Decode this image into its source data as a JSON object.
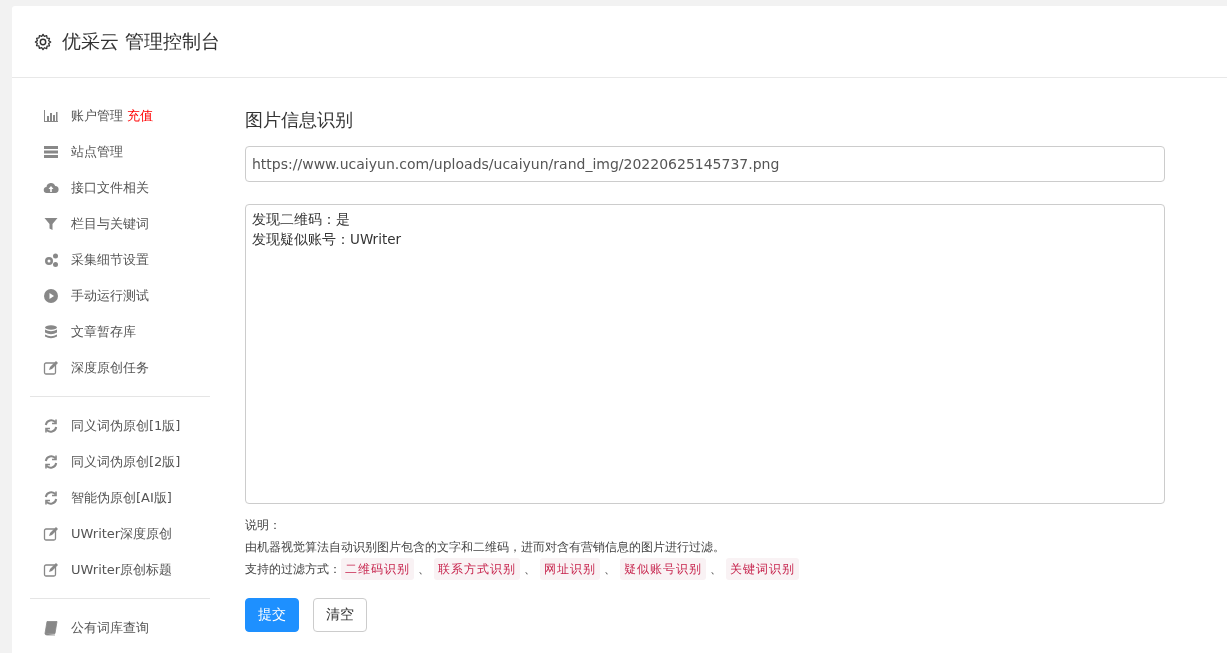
{
  "header": {
    "title": "优采云 管理控制台"
  },
  "sidebar": {
    "groups": [
      [
        {
          "label": "账户管理",
          "badge": "充值",
          "kind": "chart"
        },
        {
          "label": "站点管理",
          "kind": "server"
        },
        {
          "label": "接口文件相关",
          "kind": "cloud"
        },
        {
          "label": "栏目与关键词",
          "kind": "filter"
        },
        {
          "label": "采集细节设置",
          "kind": "gears"
        },
        {
          "label": "手动运行测试",
          "kind": "play"
        },
        {
          "label": "文章暂存库",
          "kind": "database"
        },
        {
          "label": "深度原创任务",
          "kind": "edit"
        }
      ],
      [
        {
          "label": "同义词伪原创[1版]",
          "kind": "refresh"
        },
        {
          "label": "同义词伪原创[2版]",
          "kind": "refresh"
        },
        {
          "label": "智能伪原创[AI版]",
          "kind": "refresh"
        },
        {
          "label": "UWriter深度原创",
          "kind": "edit"
        },
        {
          "label": "UWriter原创标题",
          "kind": "edit"
        }
      ],
      [
        {
          "label": "公有词库查询",
          "kind": "book"
        }
      ]
    ]
  },
  "main": {
    "title": "图片信息识别",
    "url_field": {
      "value": "https://www.ucaiyun.com/uploads/ucaiyun/rand_img/20220625145737.png"
    },
    "result_box": {
      "lines": [
        "发现二维码：是",
        "发现疑似账号：UWriter"
      ]
    },
    "note_label": "说明：",
    "note_text": "由机器视觉算法自动识别图片包含的文字和二维码，进而对含有营销信息的图片进行过滤。",
    "filters_label": "支持的过滤方式：",
    "separator": "、",
    "filters": [
      "二维码识别",
      "联系方式识别",
      "网址识别",
      "疑似账号识别",
      "关键词识别"
    ],
    "buttons": [
      {
        "label": "提交",
        "kind": "primary"
      },
      {
        "label": "清空",
        "kind": "default"
      }
    ]
  }
}
